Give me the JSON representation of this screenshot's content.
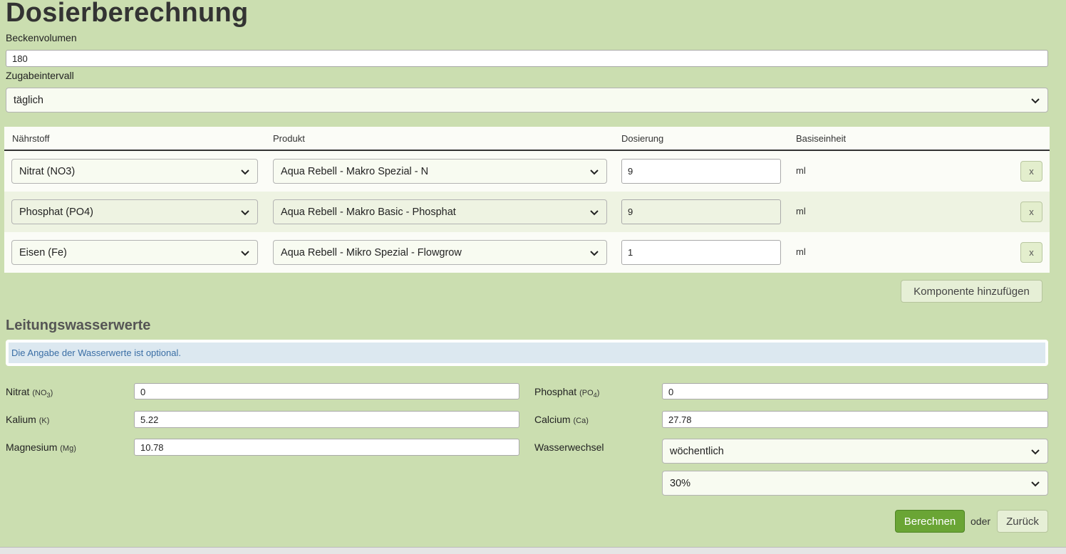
{
  "title": "Dosierberechnung",
  "volume": {
    "label": "Beckenvolumen",
    "value": "180"
  },
  "interval": {
    "label": "Zugabeintervall",
    "value": "täglich"
  },
  "table": {
    "headers": [
      "Nährstoff",
      "Produkt",
      "Dosierung",
      "Basiseinheit"
    ],
    "rows": [
      {
        "nutrient": "Nitrat (NO3)",
        "product": "Aqua Rebell - Makro Spezial - N",
        "dose": "9",
        "unit": "ml",
        "remove": "x"
      },
      {
        "nutrient": "Phosphat (PO4)",
        "product": "Aqua Rebell - Makro Basic - Phosphat",
        "dose": "9",
        "unit": "ml",
        "remove": "x"
      },
      {
        "nutrient": "Eisen (Fe)",
        "product": "Aqua Rebell - Mikro Spezial - Flowgrow",
        "dose": "1",
        "unit": "ml",
        "remove": "x"
      }
    ]
  },
  "add_component": "Komponente hinzufügen",
  "tap": {
    "title": "Leitungswasserwerte",
    "note": "Die Angabe der Wasserwerte ist optional.",
    "nitrat": {
      "label": "Nitrat",
      "sub": "(NO",
      "subscript": "3",
      "close": ")",
      "value": "0"
    },
    "phosphat": {
      "label": "Phosphat",
      "sub": "(PO",
      "subscript": "4",
      "close": ")",
      "value": "0"
    },
    "kalium": {
      "label": "Kalium",
      "sub": "(K)",
      "value": "5.22"
    },
    "calcium": {
      "label": "Calcium",
      "sub": "(Ca)",
      "value": "27.78"
    },
    "magnesium": {
      "label": "Magnesium",
      "sub": "(Mg)",
      "value": "10.78"
    },
    "wasserwechsel": {
      "label": "Wasserwechsel",
      "frequency": "wöchentlich",
      "percent": "30%"
    }
  },
  "actions": {
    "calculate": "Berechnen",
    "or": "oder",
    "back": "Zurück"
  },
  "colors": {
    "background": "#cbdeb0",
    "primary": "#6aa535",
    "alert_bg": "#dce8f0",
    "alert_text": "#3a6ea5"
  }
}
